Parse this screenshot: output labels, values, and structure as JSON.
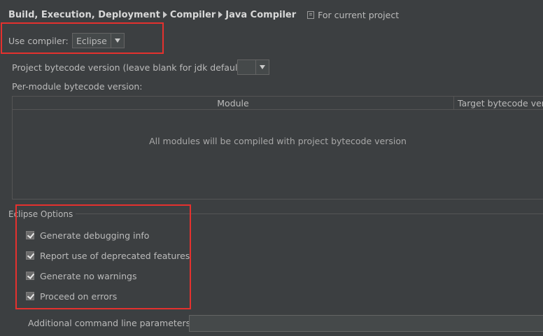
{
  "breadcrumb": {
    "items": [
      "Build, Execution, Deployment",
      "Compiler",
      "Java Compiler"
    ],
    "scope_label": "For current project"
  },
  "compiler": {
    "label": "Use compiler:",
    "value": "Eclipse"
  },
  "bytecode": {
    "label": "Project bytecode version (leave blank for jdk default):",
    "value": ""
  },
  "per_module": {
    "label": "Per-module bytecode version:",
    "columns": [
      "Module",
      "Target bytecode vers"
    ],
    "empty_text": "All modules will be compiled with project bytecode version"
  },
  "eclipse_options": {
    "title": "Eclipse Options",
    "options": [
      {
        "label": "Generate debugging info",
        "checked": true
      },
      {
        "label": "Report use of deprecated features",
        "checked": true
      },
      {
        "label": "Generate no warnings",
        "checked": true
      },
      {
        "label": "Proceed on errors",
        "checked": true
      }
    ]
  },
  "additional": {
    "label": "Additional command line parameters:",
    "value": ""
  },
  "colors": {
    "background": "#3c3f41",
    "text": "#bbbbbb",
    "highlight": "#e5312e"
  }
}
